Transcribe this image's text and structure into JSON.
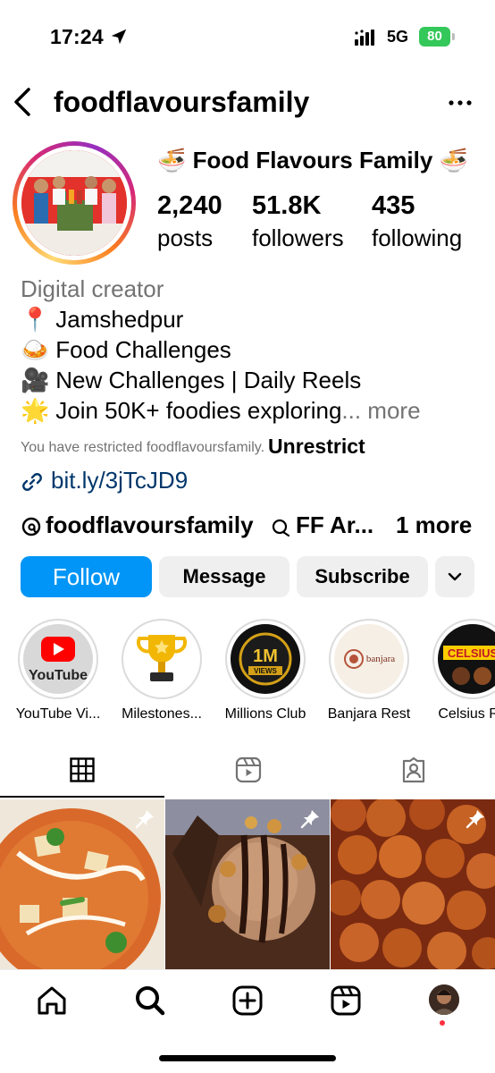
{
  "status_bar": {
    "time": "17:24",
    "network": "5G",
    "battery": "80"
  },
  "header": {
    "username": "foodflavoursfamily"
  },
  "profile": {
    "display_name": "🍜 Food Flavours Family 🍜",
    "stats": [
      {
        "value": "2,240",
        "label": "posts"
      },
      {
        "value": "51.8K",
        "label": "followers"
      },
      {
        "value": "435",
        "label": "following"
      }
    ]
  },
  "bio": {
    "category": "Digital creator",
    "lines": [
      {
        "emoji": "📍",
        "text": "Jamshedpur"
      },
      {
        "emoji": "🍛",
        "text": "Food Challenges"
      },
      {
        "emoji": "🎥",
        "text": "New Challenges | Daily Reels"
      },
      {
        "emoji": "🌟",
        "text": "Join 50K+ foodies exploring"
      }
    ],
    "more": "... more",
    "restricted_text": "You have restricted foodflavoursfamily.",
    "unrestrict": "Unrestrict",
    "link": "bit.ly/3jTcJD9",
    "threads_handle": "foodflavoursfamily",
    "ff_text": "FF Ar...",
    "one_more": "1 more"
  },
  "buttons": {
    "follow": "Follow",
    "message": "Message",
    "subscribe": "Subscribe"
  },
  "highlights": [
    {
      "label": "YouTube Vi...",
      "image_text": "YouTube"
    },
    {
      "label": "Milestones..."
    },
    {
      "label": "Millions Club",
      "image_text_1": "1M",
      "image_text_2": "VIEWS"
    },
    {
      "label": "Banjara Rest",
      "image_text": "banjara"
    },
    {
      "label": "Celsius Ro",
      "image_text": "CELSIUS"
    }
  ],
  "tabs": [
    "grid-icon",
    "reels-icon",
    "tagged-icon"
  ],
  "bottom_nav": [
    "home-icon",
    "search-icon",
    "create-icon",
    "reels-icon",
    "profile"
  ]
}
